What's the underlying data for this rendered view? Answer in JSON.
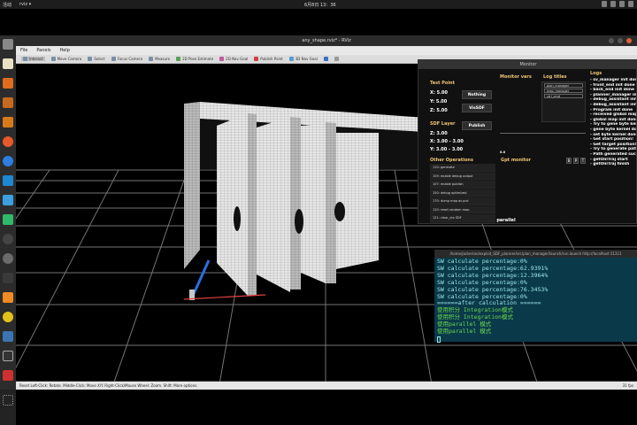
{
  "top_panel": {
    "activities": "活动",
    "app": "rviz ▾",
    "clock": "6月8日 13：36"
  },
  "window": {
    "title": "any_shape.rviz* - RViz",
    "menus": [
      "File",
      "Panels",
      "Help"
    ],
    "toolbar": [
      "Interact",
      "Move Camera",
      "Select",
      "Focus Camera",
      "Measure",
      "2D Pose Estimate",
      "2D Nav Goal",
      "Publish Point",
      "3D Nav Goal"
    ]
  },
  "statusbar": {
    "text": "Reset   Left-Click: Rotate.  Middle-Click: Move X/Y.  Right-Click/Mouse Wheel: Zoom.  Shift: More options.",
    "fps": "31 fps"
  },
  "monitor": {
    "title": "Monitor",
    "test_point": {
      "heading": "Test Point",
      "x": "X:   5.00",
      "y": "Y:   5.00",
      "z": "Z:   5.00",
      "nothing_btn": "Nothing",
      "vissdf_btn": "VisSDF"
    },
    "sdf_layer": {
      "heading": "SDF Layer",
      "publish_btn": "Publish",
      "z": "Z:   3.00",
      "x": "X:   3.00  -  3.00",
      "y": "Y:   3.00  -  3.00"
    },
    "other_ops": {
      "heading": "Other Operations",
      "items": [
        "110: generate",
        "105: enable debug output",
        "107: enable publish",
        "150: debug optimized",
        "170: dump map as pcd",
        "120: reset random map",
        "121: clear_ctx SDF"
      ]
    },
    "monitor_vars_heading": "Monitor vars",
    "log_titles_heading": "Log titles",
    "log_titles": [
      "plan_manager",
      "map_manager",
      "ctrl_cmd"
    ],
    "gpt_monitor": "Gpt monitor",
    "gpt_value": "0.0",
    "gpm_buttons": [
      "B",
      "P",
      "T"
    ],
    "logs_heading": "Logs",
    "logs": [
      "- sv_manager init done",
      "- front_end init done",
      "- back_end init done",
      "- planner_manager init",
      "- debug_assistant init",
      "- debug_assistant init",
      "- Program init done",
      "- received global map",
      "- global map init done",
      "- Try to gene byte kernel",
      "- gene byte kernel done",
      "- set byte kernel done!",
      "- Get start position!",
      "- Get target position!",
      "- Try to generate path.",
      "- Path generated success",
      "- getOnlTraj start",
      "- getOnlTraj finish"
    ]
  },
  "parallel_tab": "parallel",
  "terminal": {
    "title": "/home/jackerian/exploit_SDF_planner/src/plan_manager/launch/run.launch http://localhost:11311",
    "lines": [
      {
        "t": "SW calculate percentage:0%",
        "c": "norm"
      },
      {
        "t": "SW calculate percentage:62.9391%",
        "c": "norm"
      },
      {
        "t": "SW calculate percentage:12.3964%",
        "c": "norm"
      },
      {
        "t": "SW calculate percentage:0%",
        "c": "norm"
      },
      {
        "t": "SW calculate percentage:76.3453%",
        "c": "norm"
      },
      {
        "t": "SW calculate percentage:0%",
        "c": "norm"
      },
      {
        "t": "======after calculation ======",
        "c": "norm"
      },
      {
        "t": "使用积分 Integration模式",
        "c": "green"
      },
      {
        "t": "使用积分 Integration模式",
        "c": "green"
      },
      {
        "t": "使用parallel 模式",
        "c": "green"
      },
      {
        "t": "使用parallel 模式",
        "c": "green"
      }
    ]
  },
  "colors": {
    "terminal_bg": "#0a3a4a",
    "terminal_text": "#9be6e6",
    "terminal_green": "#6cd64e",
    "monitor_heading": "#f0c674",
    "grid": "#8a8a8a",
    "wall": "#e4e4e4",
    "axis_x": "#e04040"
  }
}
